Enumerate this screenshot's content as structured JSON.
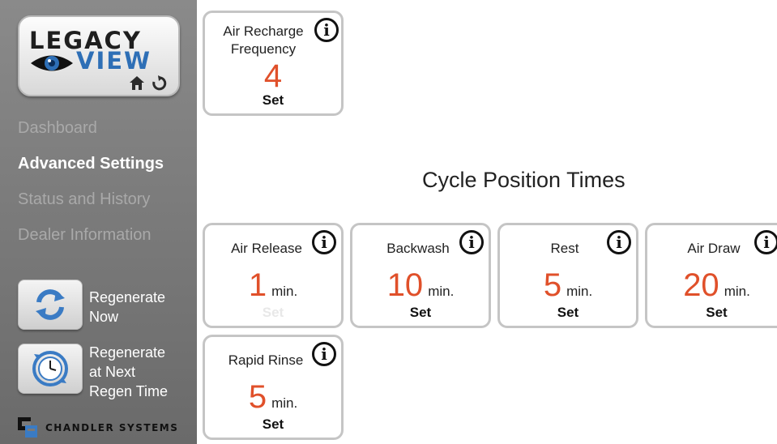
{
  "logo": {
    "line1": "LEGACY",
    "line2": "VIEW",
    "icons": [
      "home-icon",
      "refresh-icon"
    ]
  },
  "nav": {
    "items": [
      {
        "label": "Dashboard",
        "active": false
      },
      {
        "label": "Advanced Settings",
        "active": true
      },
      {
        "label": "Status and History",
        "active": false
      },
      {
        "label": "Dealer Information",
        "active": false
      }
    ]
  },
  "actions": {
    "regenerate_now": {
      "label": "Regenerate\nNow",
      "icon": "regenerate-arrows-icon"
    },
    "regenerate_next": {
      "label": "Regenerate\nat Next\nRegen Time",
      "icon": "clock-icon"
    }
  },
  "brand": {
    "text": "Chandler Systems"
  },
  "colors": {
    "accent_value": "#e0502a",
    "sidebar": "#7a7a7a",
    "logo_blue": "#2e6fb6",
    "card_border": "#c5c5c5"
  },
  "air_recharge": {
    "title": "Air Recharge\nFrequency",
    "value": "4",
    "set_label": "Set"
  },
  "section": {
    "title": "Cycle Position Times"
  },
  "cycles": [
    {
      "title": "Air Release",
      "value": "1",
      "unit": "min.",
      "set_label": "Set"
    },
    {
      "title": "Backwash",
      "value": "10",
      "unit": "min.",
      "set_label": "Set"
    },
    {
      "title": "Rest",
      "value": "5",
      "unit": "min.",
      "set_label": "Set"
    },
    {
      "title": "Air Draw",
      "value": "20",
      "unit": "min.",
      "set_label": "Set"
    },
    {
      "title": "Rapid Rinse",
      "value": "5",
      "unit": "min.",
      "set_label": "Set"
    }
  ]
}
